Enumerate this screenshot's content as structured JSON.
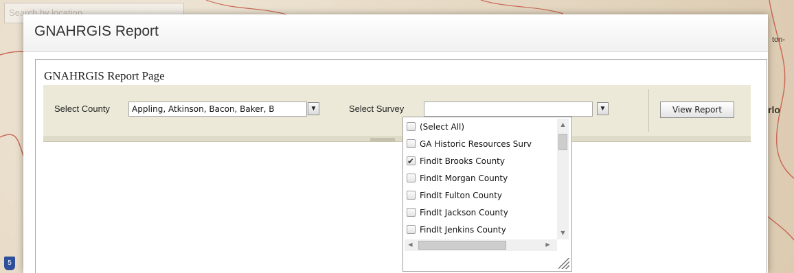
{
  "map": {
    "search_placeholder": "Search by location",
    "label_right": "rlo",
    "label_right_small": "ton-",
    "interstate": "5"
  },
  "dialog": {
    "title": "GNAHRGIS Report"
  },
  "report": {
    "page_title": "GNAHRGIS Report Page",
    "county_label": "Select County",
    "county_value": "Appling, Atkinson, Bacon, Baker, B",
    "survey_label": "Select Survey",
    "survey_value": "",
    "view_report_label": "View Report"
  },
  "survey_list": {
    "items": [
      {
        "label": "(Select All)",
        "checked": false
      },
      {
        "label": "GA Historic Resources Surv",
        "checked": false
      },
      {
        "label": "FindIt Brooks County",
        "checked": true
      },
      {
        "label": "FindIt Morgan County",
        "checked": false
      },
      {
        "label": "FindIt Fulton County",
        "checked": false
      },
      {
        "label": "FindIt Jackson County",
        "checked": false
      },
      {
        "label": "FindIt Jenkins County",
        "checked": false
      }
    ]
  },
  "icons": {
    "dropdown": "chevron-down-icon",
    "checkbox_checked": "check-icon",
    "resize": "resize-grip-icon"
  }
}
